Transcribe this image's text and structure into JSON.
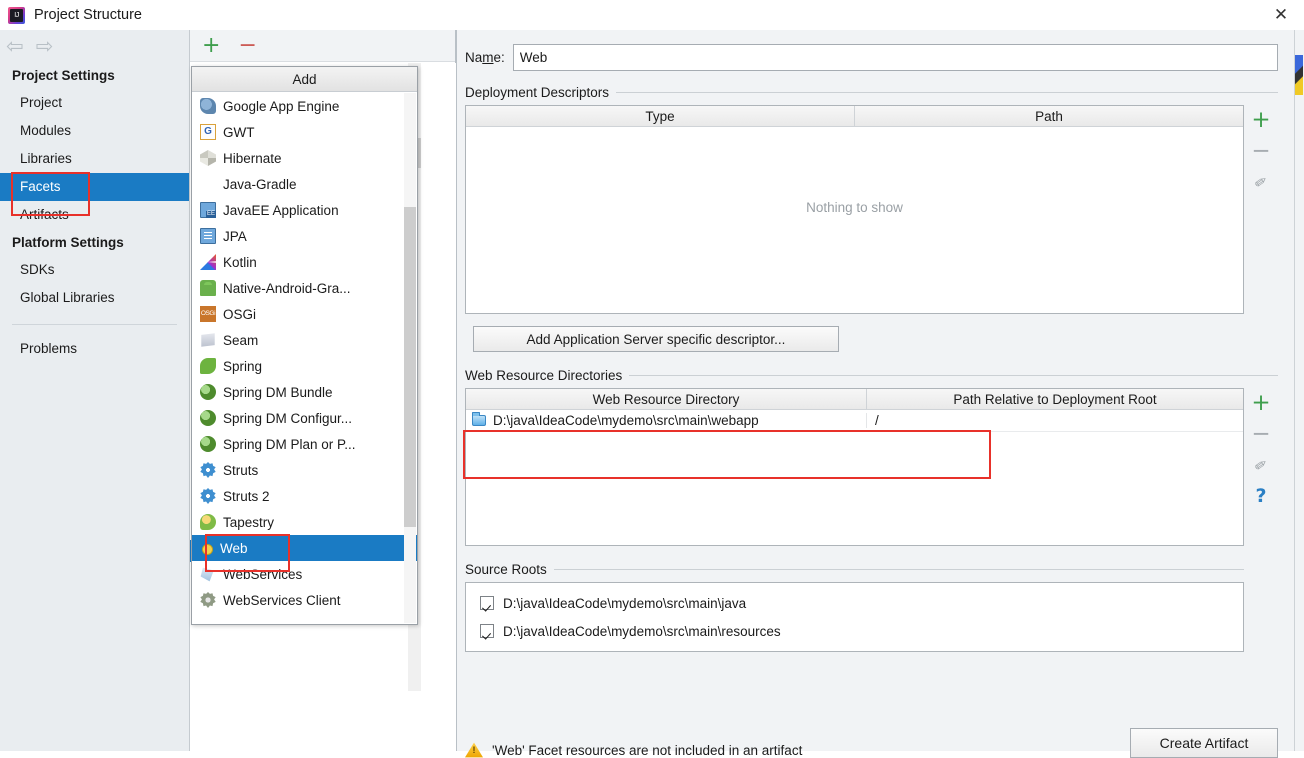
{
  "window": {
    "title": "Project Structure",
    "app_icon": "intellij-idea-icon",
    "close_label": "✕"
  },
  "nav": {
    "back_icon": "⇦",
    "forward_icon": "⇨"
  },
  "sidebar": {
    "groups": [
      {
        "title": "Project Settings",
        "items": [
          {
            "label": "Project",
            "selected": false
          },
          {
            "label": "Modules",
            "selected": false
          },
          {
            "label": "Libraries",
            "selected": false
          },
          {
            "label": "Facets",
            "selected": true
          },
          {
            "label": "Artifacts",
            "selected": false
          }
        ]
      },
      {
        "title": "Platform Settings",
        "items": [
          {
            "label": "SDKs",
            "selected": false
          },
          {
            "label": "Global Libraries",
            "selected": false
          }
        ]
      }
    ],
    "problems_label": "Problems"
  },
  "facet_toolbar": {
    "add_icon": "+",
    "remove_icon": "−"
  },
  "add_popup": {
    "header": "Add",
    "items": [
      {
        "label": "Google App Engine",
        "icon": "google-app-engine-icon",
        "selected": false
      },
      {
        "label": "GWT",
        "icon": "gwt-icon",
        "selected": false
      },
      {
        "label": "Hibernate",
        "icon": "hibernate-icon",
        "selected": false
      },
      {
        "label": "Java-Gradle",
        "icon": "",
        "selected": false
      },
      {
        "label": "JavaEE Application",
        "icon": "javaee-application-icon",
        "selected": false
      },
      {
        "label": "JPA",
        "icon": "jpa-icon",
        "selected": false
      },
      {
        "label": "Kotlin",
        "icon": "kotlin-icon",
        "selected": false
      },
      {
        "label": "Native-Android-Gra...",
        "icon": "android-icon",
        "selected": false
      },
      {
        "label": "OSGi",
        "icon": "osgi-icon",
        "selected": false
      },
      {
        "label": "Seam",
        "icon": "seam-icon",
        "selected": false
      },
      {
        "label": "Spring",
        "icon": "spring-icon",
        "selected": false
      },
      {
        "label": "Spring DM Bundle",
        "icon": "spring-dm-icon",
        "selected": false
      },
      {
        "label": "Spring DM Configur...",
        "icon": "spring-dm-icon",
        "selected": false
      },
      {
        "label": "Spring DM Plan or P...",
        "icon": "spring-dm-icon",
        "selected": false
      },
      {
        "label": "Struts",
        "icon": "struts-icon",
        "selected": false
      },
      {
        "label": "Struts 2",
        "icon": "struts-icon",
        "selected": false
      },
      {
        "label": "Tapestry",
        "icon": "tapestry-icon",
        "selected": false
      },
      {
        "label": "Web",
        "icon": "web-icon",
        "selected": true
      },
      {
        "label": "WebServices",
        "icon": "webservices-icon",
        "selected": false
      },
      {
        "label": "WebServices Client",
        "icon": "webservices-client-icon",
        "selected": false
      }
    ]
  },
  "detail": {
    "name_label_pre": "Na",
    "name_label_key": "m",
    "name_label_post": "e:",
    "name_value": "Web",
    "name_placeholder": "",
    "deployment_descriptors": {
      "title": "Deployment Descriptors",
      "columns": [
        "Type",
        "Path"
      ],
      "rows": [],
      "empty_text": "Nothing to show",
      "tools": [
        "add-icon",
        "remove-icon",
        "edit-icon"
      ],
      "descriptor_button": "Add Application Server specific descriptor..."
    },
    "web_resource_directories": {
      "title": "Web Resource Directories",
      "columns": [
        "Web Resource Directory",
        "Path Relative to Deployment Root"
      ],
      "rows": [
        {
          "directory": "D:\\java\\IdeaCode\\mydemo\\src\\main\\webapp",
          "path": "/",
          "icon": "folder-icon"
        }
      ],
      "tools": [
        "add-icon",
        "remove-icon",
        "edit-icon",
        "help-icon"
      ]
    },
    "source_roots": {
      "title": "Source Roots",
      "rows": [
        {
          "label": "D:\\java\\IdeaCode\\mydemo\\src\\main\\java",
          "checked": true
        },
        {
          "label": "D:\\java\\IdeaCode\\mydemo\\src\\main\\resources",
          "checked": true
        }
      ]
    },
    "warning": {
      "icon": "warning-icon",
      "text": "'Web' Facet resources are not included in an artifact",
      "action_label": "Create Artifact"
    }
  },
  "colors": {
    "selection_blue": "#1a7bc4",
    "annotation_red": "#e8312a",
    "add_green": "#3f9e4d",
    "remove_red": "#cc5b55",
    "help_blue": "#2b7fc4",
    "warning_yellow": "#eda400"
  }
}
